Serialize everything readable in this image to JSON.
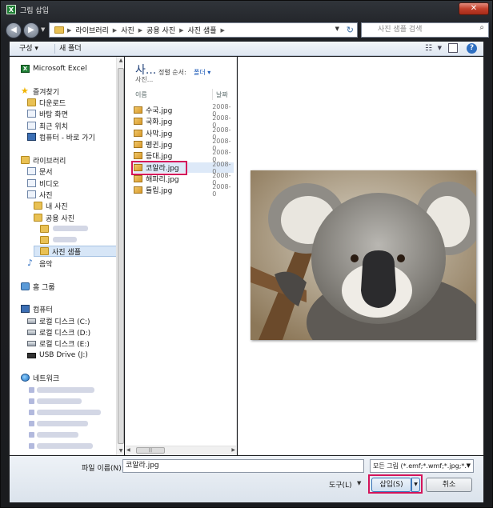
{
  "window": {
    "title": "그림 삽입",
    "app_icon": "X",
    "close_label": "✕"
  },
  "navigation": {
    "breadcrumbs": [
      "라이브러리",
      "사진",
      "공용 사진",
      "사진 샘플"
    ],
    "search_placeholder": "사진 샘플 검색"
  },
  "toolbar": {
    "organize_label": "구성 ▾",
    "new_folder_label": "새 폴더"
  },
  "sidebar": {
    "excel": "Microsoft Excel",
    "favorites": "즐겨찾기",
    "downloads": "다운로드",
    "desktop": "바탕 화면",
    "recent": "최근 위치",
    "computer_shortcut": "컴퓨터 - 바로 가기",
    "libraries": "라이브러리",
    "documents": "문서",
    "videos": "비디오",
    "pictures": "사진",
    "my_pictures": "내 사진",
    "public_pictures": "공용 사진",
    "sample_pictures": "사진 샘플",
    "music": "음악",
    "homegroup": "홈 그룹",
    "computer": "컴퓨터",
    "drive_c": "로컬 디스크 (C:)",
    "drive_d": "로컬 디스크 (D:)",
    "drive_e": "로컬 디스크 (E:)",
    "usb": "USB Drive (J:)",
    "network": "네트워크"
  },
  "file_pane": {
    "library_title": "사...",
    "library_subtitle": "사진...",
    "arrange_label": "정렬 순서:",
    "arrange_value": "폴더 ▾",
    "col_name": "이름",
    "col_date": "날짜",
    "files": [
      {
        "name": "수국.jpg",
        "date": "2008-0"
      },
      {
        "name": "국화.jpg",
        "date": "2008-0"
      },
      {
        "name": "사막.jpg",
        "date": "2008-0"
      },
      {
        "name": "펭귄.jpg",
        "date": "2008-0"
      },
      {
        "name": "등대.jpg",
        "date": "2008-0"
      },
      {
        "name": "코알라.jpg",
        "date": "2008-0"
      },
      {
        "name": "해파리.jpg",
        "date": "2008-0"
      },
      {
        "name": "튤립.jpg",
        "date": "2008-0"
      }
    ]
  },
  "bottom": {
    "filename_label": "파일 이름(N):",
    "filename_value": "코알라.jpg",
    "type_value": "모든 그림 (*.emf;*.wmf;*.jpg;*.",
    "tools_label": "도구(L)",
    "insert_label": "삽입(S)",
    "cancel_label": "취소"
  },
  "colors": {
    "highlight": "#d4145a",
    "accent": "#1e5bb8"
  }
}
